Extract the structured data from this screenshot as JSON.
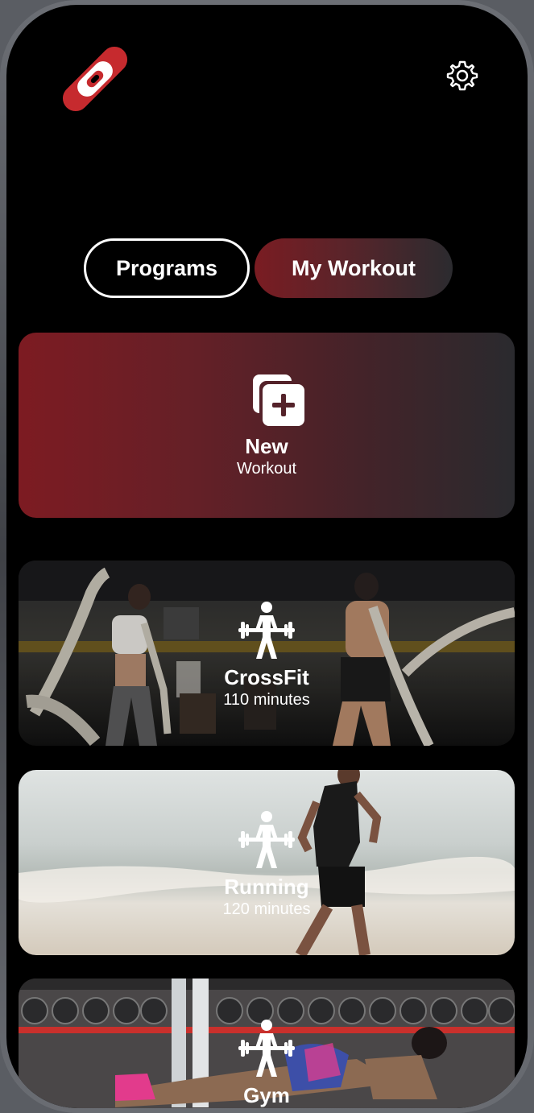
{
  "tabs": {
    "programs": "Programs",
    "my_workout": "My Workout"
  },
  "new_card": {
    "title": "New",
    "subtitle": "Workout"
  },
  "workouts": [
    {
      "title": "CrossFit",
      "subtitle": "110 minutes"
    },
    {
      "title": "Running",
      "subtitle": "120 minutes"
    },
    {
      "title": "Gym",
      "subtitle": ""
    }
  ],
  "colors": {
    "accent": "#c62a2e",
    "gradient_start": "#7d1b22",
    "gradient_end": "#2a2a2e",
    "background": "#000000",
    "text": "#ffffff"
  },
  "icons": {
    "logo": "brand-logo-icon",
    "settings": "gear-icon",
    "new_workout": "add-stack-icon",
    "workout_type": "weightlifter-icon"
  }
}
